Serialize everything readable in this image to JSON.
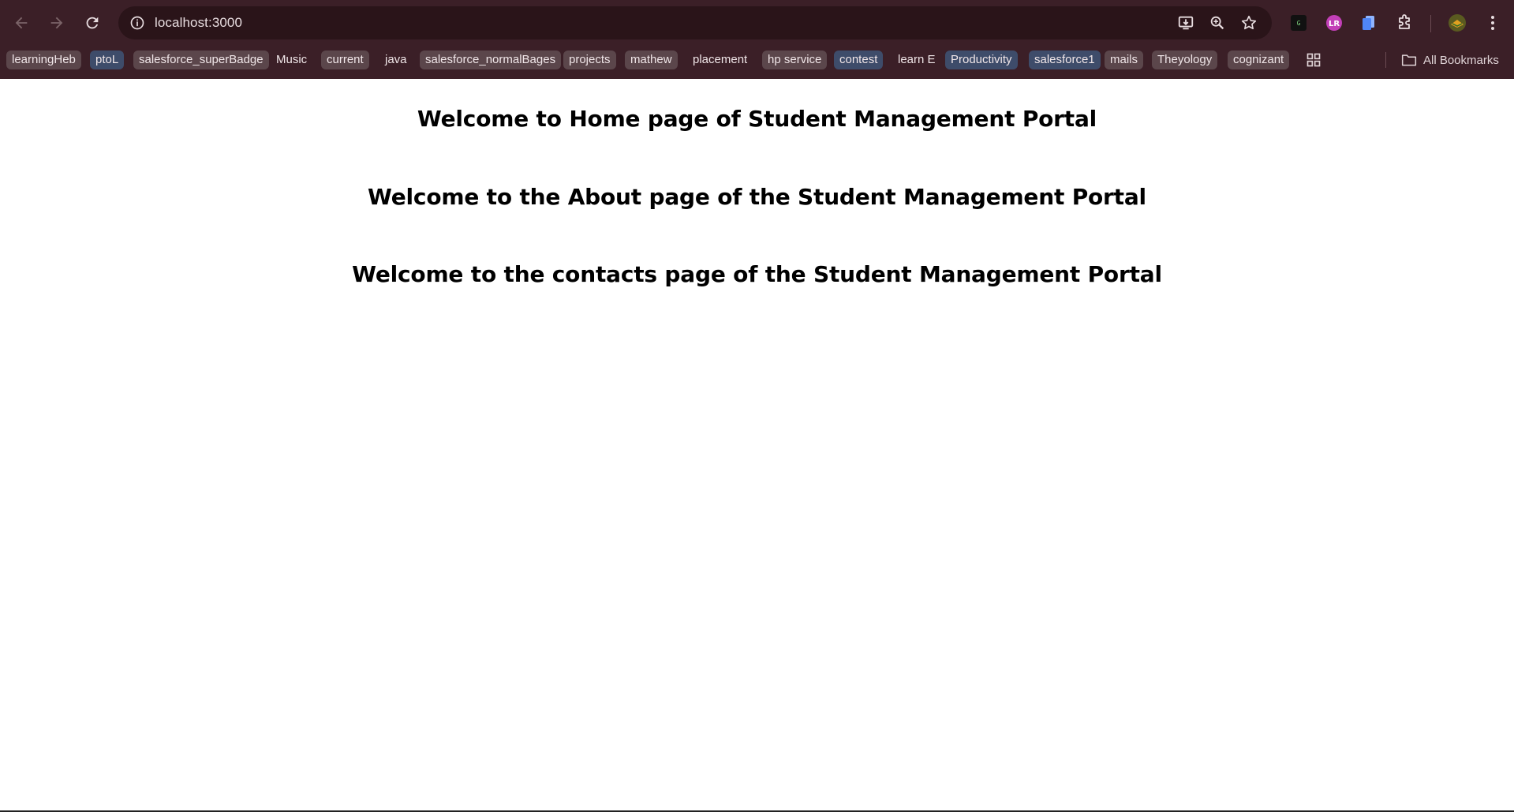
{
  "browser": {
    "url": "localhost:3000",
    "bookmarks": [
      {
        "label": "learningHeb",
        "style": "grey"
      },
      {
        "label": "ptoL",
        "style": "blue"
      },
      {
        "label": "salesforce_superBadge",
        "style": "grey"
      },
      {
        "label": "Music",
        "style": "plain"
      },
      {
        "label": "current",
        "style": "grey"
      },
      {
        "label": "java",
        "style": "plain"
      },
      {
        "label": "salesforce_normalBages",
        "style": "grey"
      },
      {
        "label": "projects",
        "style": "grey"
      },
      {
        "label": "mathew",
        "style": "grey"
      },
      {
        "label": "placement",
        "style": "plain"
      },
      {
        "label": "hp service",
        "style": "grey"
      },
      {
        "label": "contest",
        "style": "blue"
      },
      {
        "label": "learn E",
        "style": "plain"
      },
      {
        "label": "Productivity",
        "style": "blue"
      },
      {
        "label": "salesforce1",
        "style": "blue"
      },
      {
        "label": "mails",
        "style": "grey"
      },
      {
        "label": "Theyology",
        "style": "grey"
      },
      {
        "label": "cognizant",
        "style": "grey"
      }
    ],
    "all_bookmarks_label": "All Bookmarks"
  },
  "page": {
    "headings": [
      "Welcome to Home page of Student Management Portal",
      "Welcome to the About page of the Student Management Portal",
      "Welcome to the contacts page of the Student Management Portal"
    ]
  },
  "colors": {
    "chrome_bg": "#3b1f27",
    "omnibox_bg": "#2a1419",
    "bookmark_grey": "#5b464b",
    "bookmark_blue": "#3e4c6a"
  }
}
